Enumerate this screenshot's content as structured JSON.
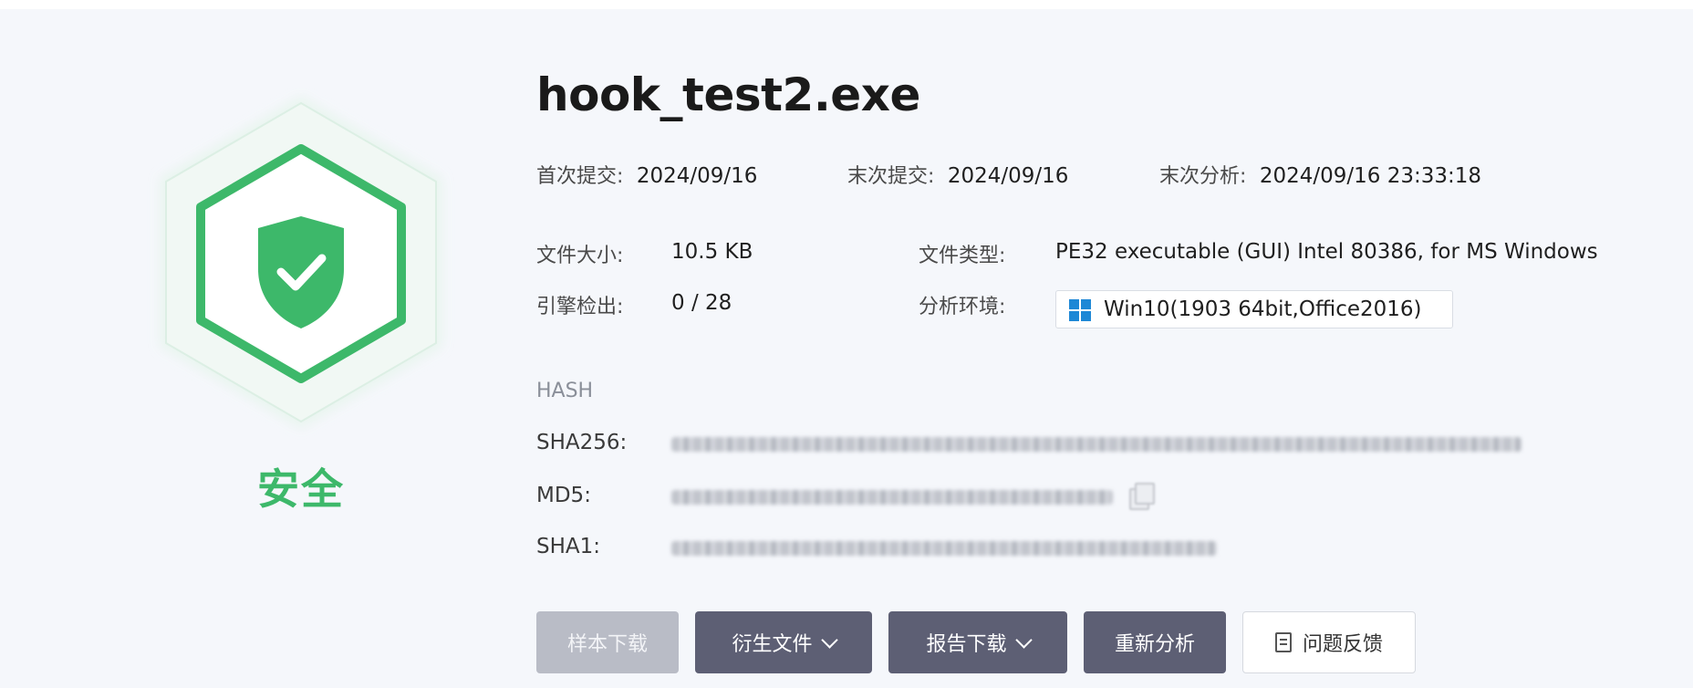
{
  "file": {
    "name": "hook_test2.exe",
    "verdict": "安全",
    "verdict_color": "#3db86a"
  },
  "dates": {
    "first_submit_label": "首次提交:",
    "first_submit_value": "2024/09/16",
    "last_submit_label": "末次提交:",
    "last_submit_value": "2024/09/16",
    "last_analysis_label": "末次分析:",
    "last_analysis_value": "2024/09/16 23:33:18"
  },
  "details": {
    "size_label": "文件大小:",
    "size_value": "10.5 KB",
    "type_label": "文件类型:",
    "type_value": "PE32 executable (GUI) Intel 80386, for MS Windows",
    "engines_label": "引擎检出:",
    "engines_value": "0 / 28",
    "env_label": "分析环境:",
    "env_value": "Win10(1903 64bit,Office2016)",
    "env_icon": "windows-icon"
  },
  "hash": {
    "heading": "HASH",
    "sha256_label": "SHA256:",
    "md5_label": "MD5:",
    "sha1_label": "SHA1:"
  },
  "actions": {
    "sample_download": "样本下载",
    "derived_files": "衍生文件",
    "report_download": "报告下载",
    "reanalyze": "重新分析",
    "feedback": "问题反馈"
  },
  "colors": {
    "accent_green": "#3db86a",
    "button_dark": "#5d5f74",
    "button_disabled": "#b9bcc6",
    "windows_blue": "#1e88d6"
  }
}
